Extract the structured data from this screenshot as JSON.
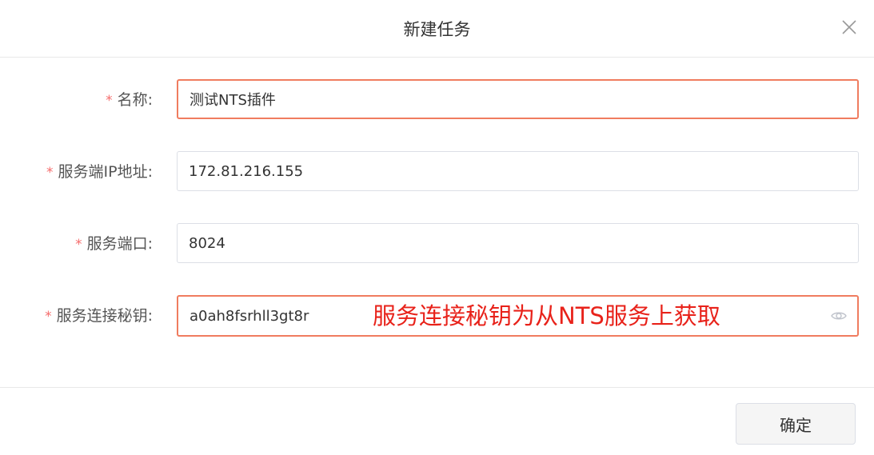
{
  "dialog": {
    "title": "新建任务"
  },
  "form": {
    "required_mark": "*",
    "name": {
      "label": "名称:",
      "value": "测试NTS插件"
    },
    "server_ip": {
      "label": "服务端IP地址:",
      "value": "172.81.216.155"
    },
    "server_port": {
      "label": "服务端口:",
      "value": "8024"
    },
    "secret_key": {
      "label": "服务连接秘钥:",
      "value": "a0ah8fsrhll3gt8r",
      "annotation": "服务连接秘钥为从NTS服务上获取"
    }
  },
  "footer": {
    "confirm_label": "确定"
  },
  "colors": {
    "required": "#f56c6c",
    "error_border": "#f07c5f",
    "annotation": "#e8221a"
  },
  "icons": {
    "close": "close-icon",
    "password_visibility": "eye-icon"
  }
}
